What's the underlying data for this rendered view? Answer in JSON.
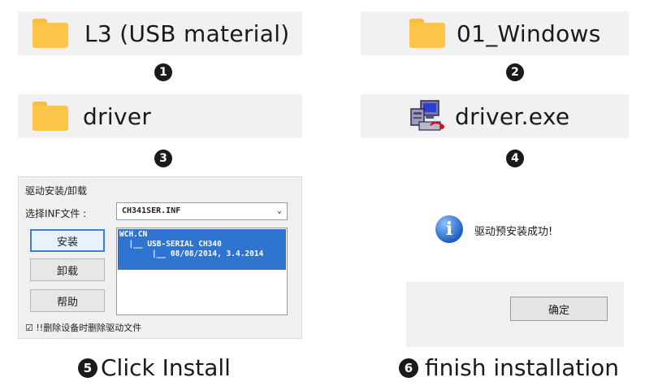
{
  "steps": [
    {
      "num": "1",
      "label": "L3 (USB material)",
      "icon": "folder-icon"
    },
    {
      "num": "2",
      "label": "01_Windows",
      "icon": "folder-icon"
    },
    {
      "num": "3",
      "label": "driver",
      "icon": "folder-icon"
    },
    {
      "num": "4",
      "label": "driver.exe",
      "icon": "exe-icon"
    }
  ],
  "install_dialog": {
    "group_title": "驱动安装/卸载",
    "inf_label": "选择INF文件 :",
    "inf_value": "CH341SER.INF",
    "dropdown_arrow": "⌄",
    "buttons": {
      "install": "安装",
      "uninstall": "卸载",
      "help": "帮助"
    },
    "list_lines": [
      "WCH.CN",
      "  |__ USB-SERIAL CH340",
      "       |__ 08/08/2014, 3.4.2014"
    ],
    "checkbox_label": "!!删除设备时删除驱动文件",
    "checkbox_checked": true
  },
  "success_dialog": {
    "message": "驱动预安装成功!",
    "ok_label": "确定",
    "info_glyph": "i"
  },
  "captions": {
    "step5_num": "5",
    "step5": "Click Install",
    "step6_num": "6",
    "step6": "finish installation"
  }
}
